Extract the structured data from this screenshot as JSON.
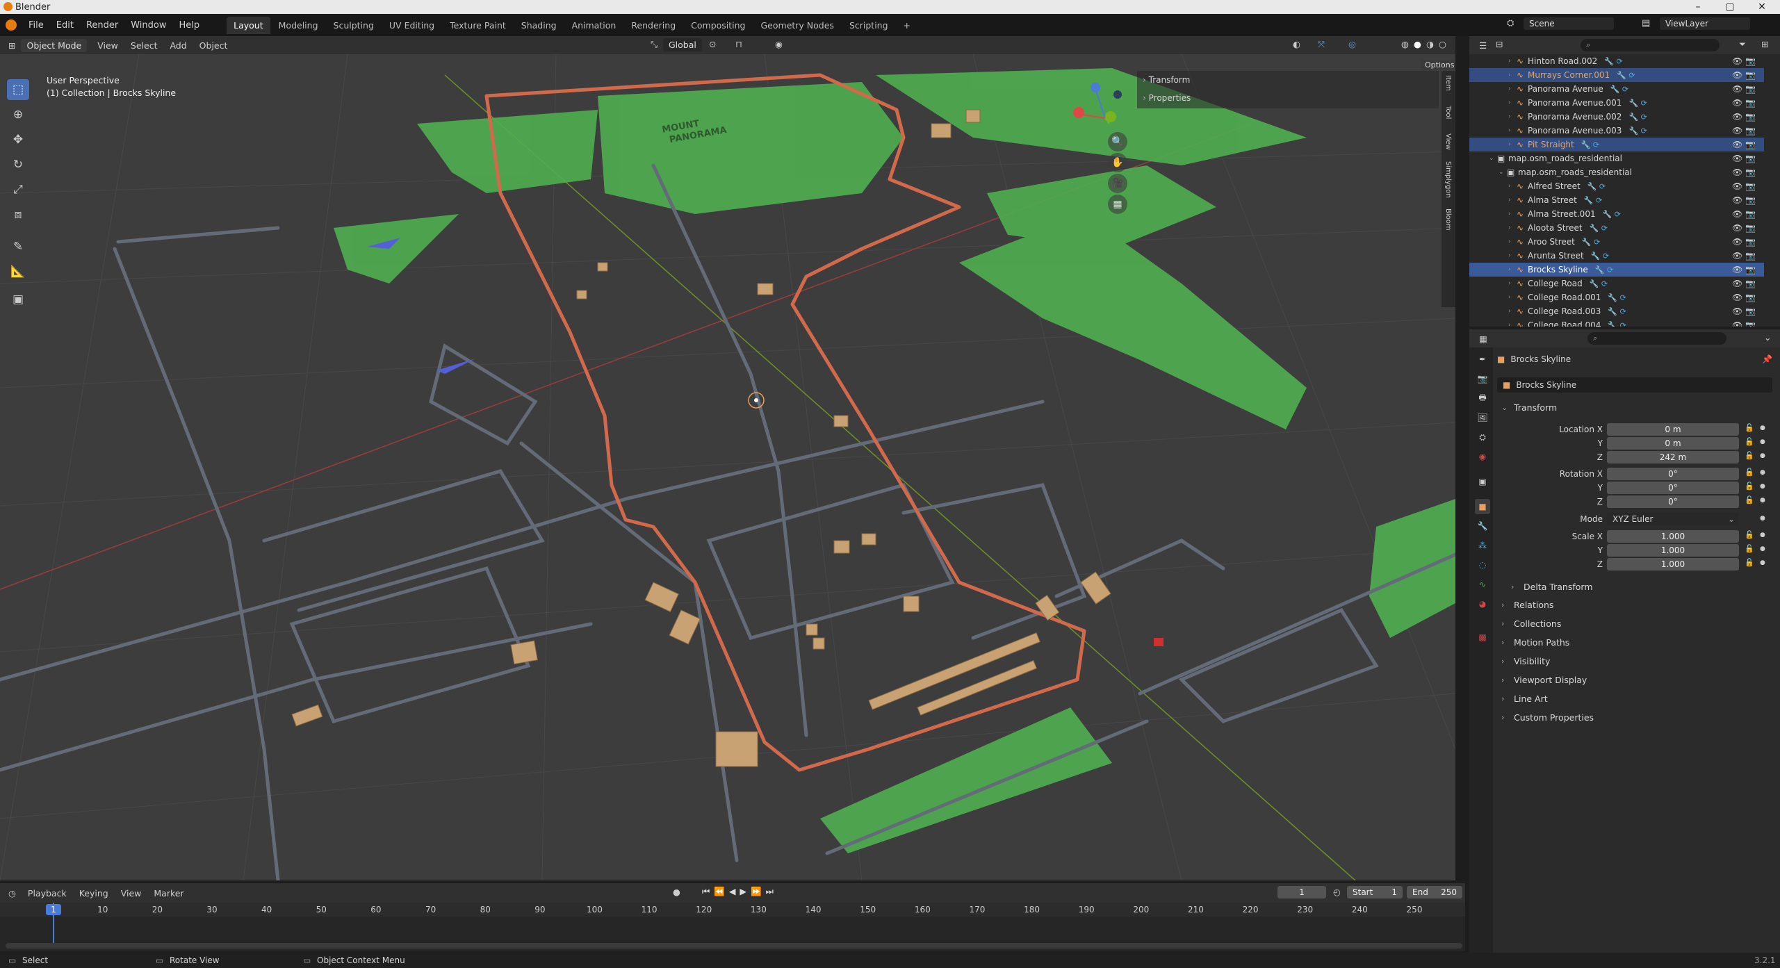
{
  "window": {
    "title": "Blender",
    "controls": [
      "–",
      "▢",
      "✕"
    ]
  },
  "menus": [
    "File",
    "Edit",
    "Render",
    "Window",
    "Help"
  ],
  "workspaces": [
    "Layout",
    "Modeling",
    "Sculpting",
    "UV Editing",
    "Texture Paint",
    "Shading",
    "Animation",
    "Rendering",
    "Compositing",
    "Geometry Nodes",
    "Scripting",
    "+"
  ],
  "scene": {
    "label": "Scene",
    "view_layer": "ViewLayer"
  },
  "viewport_header": {
    "mode": "Object Mode",
    "menus": [
      "View",
      "Select",
      "Add",
      "Object"
    ],
    "orientation": "Global",
    "options": "Options"
  },
  "viewport": {
    "perspective": "User Perspective",
    "collection_info": "(1) Collection | Brocks Skyline",
    "map_label_1": "MOUNT",
    "map_label_2": "PANORAMA"
  },
  "n_panel": {
    "transform": "Transform",
    "properties": "Properties",
    "tabs": [
      "Item",
      "Tool",
      "View",
      "Simplygon",
      "Bloom"
    ]
  },
  "outliner": {
    "search_placeholder": "",
    "rows": [
      {
        "name": "Hinton Road.002",
        "color": "#d6d6d6",
        "indent": 3,
        "selected": false
      },
      {
        "name": "Murrays Corner.001",
        "color": "#e8a060",
        "indent": 3,
        "selected": true
      },
      {
        "name": "Panorama Avenue",
        "color": "#d6d6d6",
        "indent": 3,
        "selected": false
      },
      {
        "name": "Panorama Avenue.001",
        "color": "#d6d6d6",
        "indent": 3,
        "selected": false
      },
      {
        "name": "Panorama Avenue.002",
        "color": "#d6d6d6",
        "indent": 3,
        "selected": false
      },
      {
        "name": "Panorama Avenue.003",
        "color": "#d6d6d6",
        "indent": 3,
        "selected": false
      },
      {
        "name": "Pit Straight",
        "color": "#e8a060",
        "indent": 3,
        "selected": true
      },
      {
        "name": "map.osm_roads_residential",
        "color": "#d6d6d6",
        "indent": 1,
        "selected": false
      },
      {
        "name": "map.osm_roads_residential",
        "color": "#d6d6d6",
        "indent": 2,
        "selected": false
      },
      {
        "name": "Alfred Street",
        "color": "#d6d6d6",
        "indent": 3,
        "selected": false
      },
      {
        "name": "Alma Street",
        "color": "#d6d6d6",
        "indent": 3,
        "selected": false
      },
      {
        "name": "Alma Street.001",
        "color": "#d6d6d6",
        "indent": 3,
        "selected": false
      },
      {
        "name": "Aloota Street",
        "color": "#d6d6d6",
        "indent": 3,
        "selected": false
      },
      {
        "name": "Aroo Street",
        "color": "#d6d6d6",
        "indent": 3,
        "selected": false
      },
      {
        "name": "Arunta Street",
        "color": "#d6d6d6",
        "indent": 3,
        "selected": false
      },
      {
        "name": "Brocks Skyline",
        "color": "#ffffff",
        "indent": 3,
        "selected": true,
        "active": true
      },
      {
        "name": "College Road",
        "color": "#d6d6d6",
        "indent": 3,
        "selected": false
      },
      {
        "name": "College Road.001",
        "color": "#d6d6d6",
        "indent": 3,
        "selected": false
      },
      {
        "name": "College Road.003",
        "color": "#d6d6d6",
        "indent": 3,
        "selected": false
      },
      {
        "name": "College Road.004",
        "color": "#d6d6d6",
        "indent": 3,
        "selected": false
      }
    ]
  },
  "properties": {
    "object_name": "Brocks Skyline",
    "data_name": "Brocks Skyline",
    "transform_label": "Transform",
    "location": {
      "label": "Location X",
      "x": "0 m",
      "y": "0 m",
      "z": "242 m"
    },
    "rotation": {
      "label": "Rotation X",
      "x": "0°",
      "y": "0°",
      "z": "0°"
    },
    "mode": {
      "label": "Mode",
      "value": "XYZ Euler"
    },
    "scale": {
      "label": "Scale X",
      "x": "1.000",
      "y": "1.000",
      "z": "1.000"
    },
    "axis_y": "Y",
    "axis_z": "Z",
    "delta": "Delta Transform",
    "panels": [
      "Relations",
      "Collections",
      "Motion Paths",
      "Visibility",
      "Viewport Display",
      "Line Art",
      "Custom Properties"
    ]
  },
  "timeline": {
    "menus": [
      "Playback",
      "Keying",
      "View",
      "Marker"
    ],
    "current_frame": "1",
    "start_label": "Start",
    "start": "1",
    "end_label": "End",
    "end": "250",
    "ticks": [
      "1",
      "10",
      "20",
      "30",
      "40",
      "50",
      "60",
      "70",
      "80",
      "90",
      "100",
      "110",
      "120",
      "130",
      "140",
      "150",
      "160",
      "170",
      "180",
      "190",
      "200",
      "210",
      "220",
      "230",
      "240",
      "250"
    ]
  },
  "statusbar": {
    "select": "Select",
    "rotate": "Rotate View",
    "context": "Object Context Menu",
    "version": "3.2.1"
  },
  "colors": {
    "accent": "#4a6fb5",
    "grass": "#4fae50",
    "track": "#d2694a",
    "road": "#646b78",
    "building": "#c8a272"
  }
}
